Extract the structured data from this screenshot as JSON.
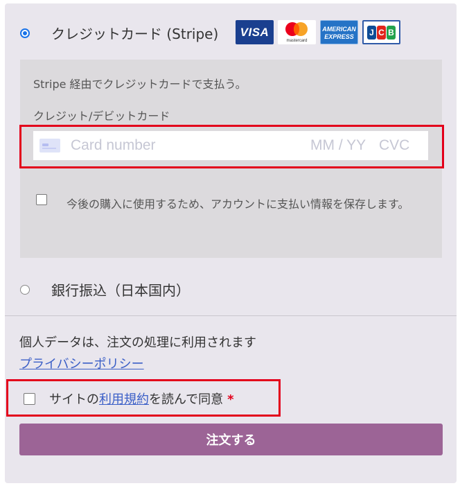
{
  "payment_methods": [
    {
      "label": "クレジットカード (Stripe)",
      "selected": true
    },
    {
      "label": "銀行振込（日本国内）",
      "selected": false
    }
  ],
  "card_brands": {
    "visa": "VISA",
    "mastercard": "mastercard",
    "amex_line1": "AMERICAN",
    "amex_line2": "EXPRESS",
    "jcb": [
      "J",
      "C",
      "B"
    ]
  },
  "stripe": {
    "description": "Stripe 経由でクレジットカードで支払う。",
    "field_label": "クレジット/デビットカード",
    "card_number_placeholder": "Card number",
    "expiry_placeholder": "MM / YY",
    "cvc_placeholder": "CVC",
    "save_label": "今後の購入に使用するため、アカウントに支払い情報を保存します。",
    "save_checked": false
  },
  "privacy": {
    "text": "個人データは、注文の処理に利用されます",
    "link": "プライバシーポリシー"
  },
  "terms": {
    "prefix": "サイトの",
    "link": "利用規約",
    "suffix": "を読んで同意",
    "required_mark": "*",
    "checked": false
  },
  "order_button": "注文する",
  "colors": {
    "accent": "#9c6496",
    "link": "#3b5fc7",
    "highlight": "#e3001b",
    "radio_selected": "#1a73e8"
  }
}
